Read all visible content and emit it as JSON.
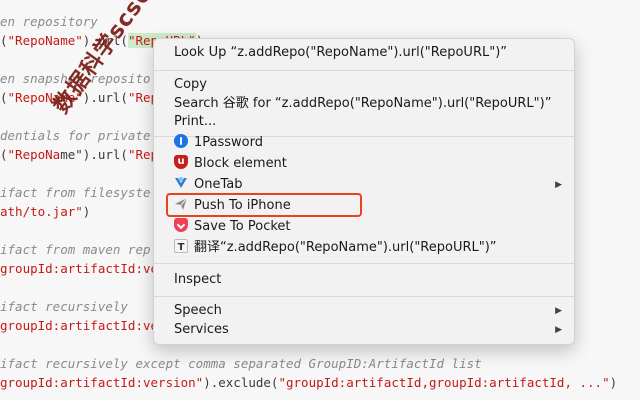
{
  "code": {
    "lines": [
      {
        "seg": [
          {
            "t": "en repository",
            "c": "comment"
          }
        ]
      },
      {
        "seg": [
          {
            "t": "(",
            "c": ""
          },
          {
            "t": "\"RepoName\"",
            "c": "str"
          },
          {
            "t": ").url(",
            "c": ""
          },
          {
            "t": "\"RepoURL\"",
            "c": "str hl"
          },
          {
            "t": ")",
            "c": ""
          }
        ]
      },
      {
        "seg": [
          {
            "t": "",
            "c": ""
          }
        ]
      },
      {
        "seg": [
          {
            "t": "en snapshot reposito",
            "c": "comment"
          }
        ]
      },
      {
        "seg": [
          {
            "t": "(",
            "c": ""
          },
          {
            "t": "\"RepoName\"",
            "c": "str"
          },
          {
            "t": ").url(",
            "c": ""
          },
          {
            "t": "\"Rep",
            "c": "str"
          }
        ]
      },
      {
        "seg": [
          {
            "t": "",
            "c": ""
          }
        ]
      },
      {
        "seg": [
          {
            "t": "dentials for private",
            "c": "comment"
          }
        ]
      },
      {
        "seg": [
          {
            "t": "(",
            "c": ""
          },
          {
            "t": "\"RepoNa",
            "c": "str"
          },
          {
            "t": "me\").url(",
            "c": ""
          },
          {
            "t": "\"Rep",
            "c": "str"
          }
        ]
      },
      {
        "seg": [
          {
            "t": "",
            "c": ""
          }
        ]
      },
      {
        "seg": [
          {
            "t": "ifact from filesyste",
            "c": "comment"
          }
        ]
      },
      {
        "seg": [
          {
            "t": "ath/to.jar\"",
            "c": "str"
          },
          {
            "t": ")",
            "c": ""
          }
        ]
      },
      {
        "seg": [
          {
            "t": "",
            "c": ""
          }
        ]
      },
      {
        "seg": [
          {
            "t": "ifact from maven rep",
            "c": "comment"
          }
        ]
      },
      {
        "seg": [
          {
            "t": "groupId:artifactId:ver",
            "c": "str"
          }
        ]
      },
      {
        "seg": [
          {
            "t": "",
            "c": ""
          }
        ]
      },
      {
        "seg": [
          {
            "t": "ifact recursively",
            "c": "comment"
          }
        ]
      },
      {
        "seg": [
          {
            "t": "groupId:artifactId:ver",
            "c": "str"
          }
        ]
      },
      {
        "seg": [
          {
            "t": "",
            "c": ""
          }
        ]
      },
      {
        "seg": [
          {
            "t": "ifact recursively except comma separated GroupID:ArtifactId list",
            "c": "comment"
          }
        ]
      },
      {
        "seg": [
          {
            "t": "groupId:artifactId:version\"",
            "c": "str"
          },
          {
            "t": ").exclude(",
            "c": ""
          },
          {
            "t": "\"groupId:artifactId,groupId:artifactId, ...\"",
            "c": "str"
          },
          {
            "t": ")",
            "c": ""
          }
        ]
      }
    ]
  },
  "watermark": "数据科学scs66",
  "menu": {
    "items": [
      {
        "name": "menu-item-look-up",
        "label": "Look Up “z.addRepo(\"RepoName\").url(\"RepoURL\")”"
      },
      {
        "name": "menu-item-copy",
        "label": "Copy"
      },
      {
        "name": "menu-item-search",
        "label": "Search 谷歌 for “z.addRepo(\"RepoName\").url(\"RepoURL\")”"
      },
      {
        "name": "menu-item-print",
        "label": "Print..."
      },
      {
        "name": "menu-item-1password",
        "label": "1Password",
        "icon": "1password-icon"
      },
      {
        "name": "menu-item-block-element",
        "label": "Block element",
        "icon": "ublock-icon"
      },
      {
        "name": "menu-item-onetab",
        "label": "OneTab",
        "icon": "onetab-icon",
        "submenu": true
      },
      {
        "name": "menu-item-push-to-iphone",
        "label": "Push To iPhone",
        "icon": "paper-plane-icon"
      },
      {
        "name": "menu-item-save-to-pocket",
        "label": "Save To Pocket",
        "icon": "pocket-icon"
      },
      {
        "name": "menu-item-translate",
        "label": "翻译“z.addRepo(\"RepoName\").url(\"RepoURL\")”",
        "icon": "translate-icon"
      },
      {
        "name": "menu-item-inspect",
        "label": "Inspect"
      },
      {
        "name": "menu-item-speech",
        "label": "Speech",
        "submenu": true
      },
      {
        "name": "menu-item-services",
        "label": "Services",
        "submenu": true
      }
    ],
    "submenu_arrow": "▶",
    "highlight_color": "#e8431c"
  }
}
